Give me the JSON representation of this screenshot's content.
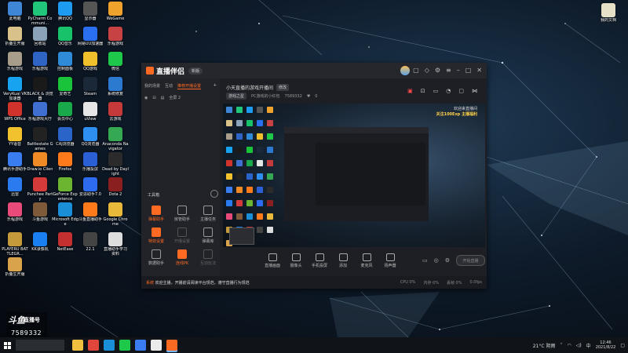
{
  "desktop": {
    "icons": [
      {
        "label": "此电脑",
        "color": "#3f86d6"
      },
      {
        "label": "PyCharm Communi...",
        "color": "#20c77a"
      },
      {
        "label": "腾讯QQ",
        "color": "#1d9bf0"
      },
      {
        "label": "显示器",
        "color": "#555555"
      },
      {
        "label": "WeGame",
        "color": "#f0a32c"
      },
      {
        "label": "折叠生开服",
        "color": "#d8c28a"
      },
      {
        "label": "回收站",
        "color": "#8aa3b8"
      },
      {
        "label": "QQ音乐",
        "color": "#17c26a"
      },
      {
        "label": "网易UU加速器",
        "color": "#2a6ff0"
      },
      {
        "label": "乐程游戏",
        "color": "#c74343"
      },
      {
        "label": "乐程游戏",
        "color": "#a89c8b"
      },
      {
        "label": "乐程游戏",
        "color": "#2f63c4"
      },
      {
        "label": "控制面板",
        "color": "#2f8ad8"
      },
      {
        "label": "QQ游戏",
        "color": "#f0c02c"
      },
      {
        "label": "微信",
        "color": "#1ec84b"
      },
      {
        "label": "VeryKuai VK 加速器",
        "color": "#18a3f0"
      },
      {
        "label": "BLACK & 浏览器",
        "color": "#1a1a1a"
      },
      {
        "label": "爱奇艺",
        "color": "#19c33a"
      },
      {
        "label": "Steam",
        "color": "#1b2838"
      },
      {
        "label": "系统修复",
        "color": "#2c7ad0"
      },
      {
        "label": "WPS Office",
        "color": "#d0322c"
      },
      {
        "label": "乐程游戏大厅",
        "color": "#3f6fd1"
      },
      {
        "label": "会员中心",
        "color": "#19a84a"
      },
      {
        "label": "uView",
        "color": "#e6e6e6"
      },
      {
        "label": "云游戏",
        "color": "#c43a3a"
      },
      {
        "label": "YY语音",
        "color": "#f2c12e"
      },
      {
        "label": "Battlestate Games",
        "color": "#222222"
      },
      {
        "label": "CAJ浏览器",
        "color": "#2b64c8"
      },
      {
        "label": "QQ浏览器",
        "color": "#2f8ff0"
      },
      {
        "label": "Anaconda Navigator",
        "color": "#34a853"
      },
      {
        "label": "腾讯手游助手",
        "color": "#3a7df0"
      },
      {
        "label": "Draw.io Client",
        "color": "#f08a24"
      },
      {
        "label": "Firefox",
        "color": "#ff7a1a"
      },
      {
        "label": "乐播投屏",
        "color": "#2a5fd6"
      },
      {
        "label": "Dead by Daylight",
        "color": "#2b2b2b"
      },
      {
        "label": "迅雷",
        "color": "#2a7bf0"
      },
      {
        "label": "Punchee Party",
        "color": "#d43a3a"
      },
      {
        "label": "GeForce Experience",
        "color": "#6cb531"
      },
      {
        "label": "爱思助手7.0",
        "color": "#2d6cf0"
      },
      {
        "label": "Dota 2",
        "color": "#8a1f1f"
      },
      {
        "label": "乐程游戏",
        "color": "#e84a7a"
      },
      {
        "label": "斗鱼游戏",
        "color": "#7e5a3a"
      },
      {
        "label": "Microsoft Edge",
        "color": "#1a8fd8"
      },
      {
        "label": "斗鱼直播助手",
        "color": "#ff7a1a"
      },
      {
        "label": "Google Chrome",
        "color": "#e8b83a"
      },
      {
        "label": "PLAYERU BATTLEGR...",
        "color": "#c49a3a"
      },
      {
        "label": "KK录像机",
        "color": "#1a7ff0"
      },
      {
        "label": "NetEase",
        "color": "#c43030"
      },
      {
        "label": "22.1",
        "color": "#444444"
      },
      {
        "label": "直播助手学习资料",
        "color": "#dddddd"
      },
      {
        "label": "折叠生开服",
        "color": "#d8a34a"
      }
    ],
    "right_icon": {
      "label": "我的文档",
      "color": "#e6e0c8"
    }
  },
  "app": {
    "logo_text": "直播伴侣",
    "version_badge": "新版",
    "tabs": [
      "我的场景",
      "互动",
      "推荐开播设置"
    ],
    "left_tools": [
      "",
      "",
      "全屏 2"
    ],
    "toolbox_label": "工具箱",
    "tools": [
      {
        "label": "弹幕助手",
        "style": "hot"
      },
      {
        "label": "房管助手",
        "style": ""
      },
      {
        "label": "主播任务",
        "style": ""
      },
      {
        "label": "特效设置",
        "style": "hot"
      },
      {
        "label": "开播设置",
        "style": "dim"
      },
      {
        "label": "弹幕库",
        "style": ""
      },
      {
        "label": "数据助手",
        "style": ""
      },
      {
        "label": "连线PK",
        "style": "hot"
      },
      {
        "label": "互动玩法",
        "style": "dim"
      }
    ],
    "scene": {
      "title": "小天直播的游戏开播间",
      "edit_label": "修改",
      "category_chip": "游戏之星",
      "sub_text": "PC游戏的小红包",
      "room_id": "7589332",
      "likes": "0"
    },
    "preview": {
      "promo_line1": "欢迎来直播间",
      "promo_line2": "关注100Exp 主播福利"
    },
    "actions": [
      {
        "label": "直播画面"
      },
      {
        "label": "摄像头"
      },
      {
        "label": "手机投屏"
      },
      {
        "label": "添加"
      },
      {
        "label": "麦克风"
      },
      {
        "label": "扬声器"
      }
    ],
    "start_button": "开始直播",
    "status": {
      "lead": "系统",
      "message": "欢迎主播，开播前请阅读平台规范，遵守直播行为规范",
      "stats": [
        "CPU 0%",
        "内存 0%",
        "丢帧 0%",
        "0.0fps"
      ]
    }
  },
  "streamer_badge": {
    "logo": "斗鱼",
    "name": "直播号",
    "room": "7589332"
  },
  "taskbar": {
    "weather": "21°C 阴雨",
    "time": "12:46",
    "date": "2021/8/22",
    "apps": [
      {
        "name": "file-explorer",
        "color": "#f0c040",
        "active": false
      },
      {
        "name": "chrome",
        "color": "#e0463a",
        "active": false
      },
      {
        "name": "edge",
        "color": "#1a8fd8",
        "active": false
      },
      {
        "name": "wechat",
        "color": "#1ec84b",
        "active": false
      },
      {
        "name": "mail",
        "color": "#3a7df0",
        "active": false
      },
      {
        "name": "qq",
        "color": "#eaeaea",
        "active": false
      },
      {
        "name": "live-companion",
        "color": "#ff6a22",
        "active": true
      }
    ]
  }
}
